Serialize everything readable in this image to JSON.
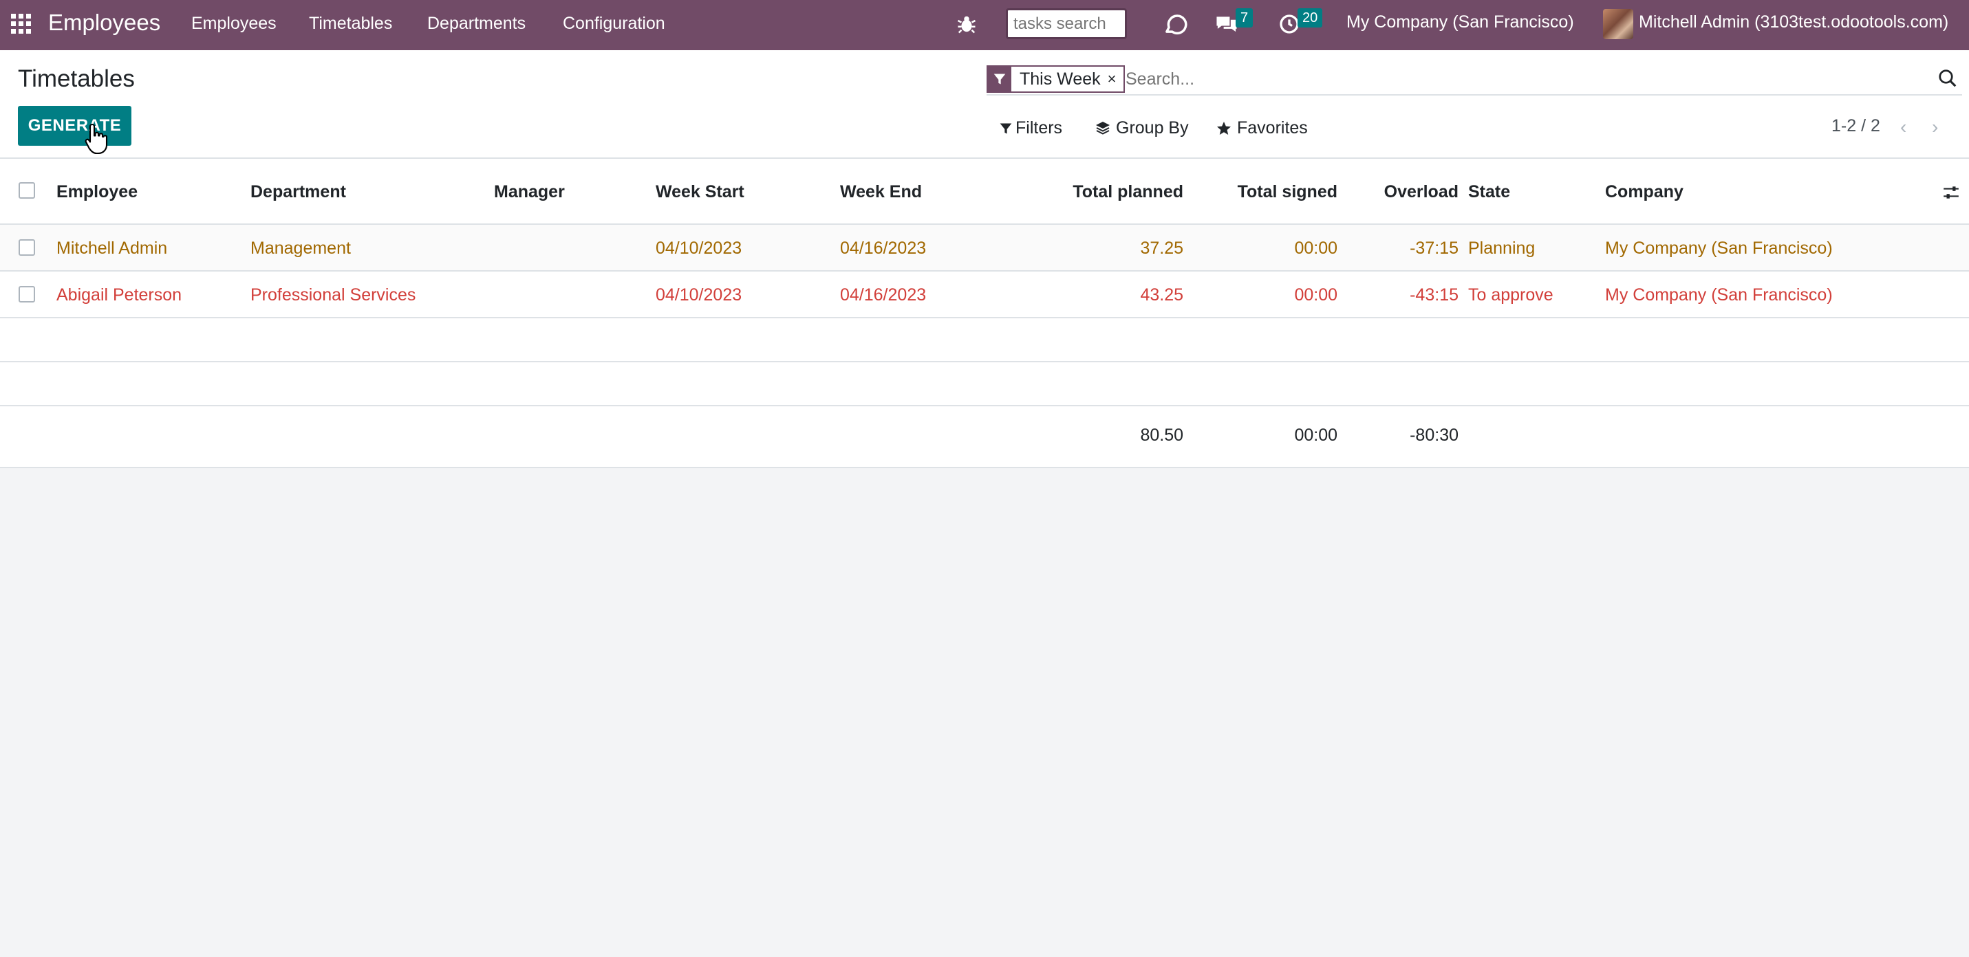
{
  "navbar": {
    "app_name": "Employees",
    "menu": [
      "Employees",
      "Timetables",
      "Departments",
      "Configuration"
    ],
    "tasks_search_placeholder": "tasks search",
    "messages_count": "7",
    "activities_count": "20",
    "company": "My Company (San Francisco)",
    "user": "Mitchell Admin (3103test.odootools.com)"
  },
  "control_panel": {
    "title": "Timetables",
    "generate_label": "GENERATE",
    "facet_label": "This Week",
    "facet_remove": "×",
    "search_placeholder": "Search...",
    "filters_label": "Filters",
    "group_by_label": "Group By",
    "favorites_label": "Favorites",
    "pager": "1-2 / 2"
  },
  "table": {
    "headers": {
      "employee": "Employee",
      "department": "Department",
      "manager": "Manager",
      "week_start": "Week Start",
      "week_end": "Week End",
      "total_planned": "Total planned",
      "total_signed": "Total signed",
      "overload": "Overload",
      "state": "State",
      "company": "Company"
    },
    "rows": [
      {
        "employee": "Mitchell Admin",
        "department": "Management",
        "manager": "",
        "week_start": "04/10/2023",
        "week_end": "04/16/2023",
        "total_planned": "37.25",
        "total_signed": "00:00",
        "overload": "-37:15",
        "state": "Planning",
        "company": "My Company (San Francisco)"
      },
      {
        "employee": "Abigail Peterson",
        "department": "Professional Services",
        "manager": "",
        "week_start": "04/10/2023",
        "week_end": "04/16/2023",
        "total_planned": "43.25",
        "total_signed": "00:00",
        "overload": "-43:15",
        "state": "To approve",
        "company": "My Company (San Francisco)"
      }
    ],
    "totals": {
      "total_planned": "80.50",
      "total_signed": "00:00",
      "overload": "-80:30"
    }
  },
  "colors": {
    "navbar": "#714b67",
    "primary_button": "#017e84",
    "state_planning": "#a16800",
    "state_to_approve": "#d23f3a"
  }
}
